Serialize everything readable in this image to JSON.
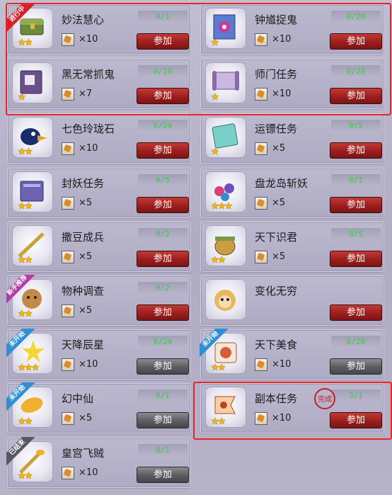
{
  "tag_labels": {
    "active": "进行中",
    "new": "新手推荐",
    "notyet": "未开始",
    "ended": "已结束"
  },
  "seal_text": "完成",
  "quests": [
    {
      "id": "miaofa",
      "name": "妙法慧心",
      "progress": "0/1",
      "qty": "×10",
      "stars": 2,
      "button": "参加",
      "button_style": "red",
      "tag": "active",
      "art": "chest"
    },
    {
      "id": "zhongkui",
      "name": "钟馗捉鬼",
      "progress": "0/20",
      "qty": "×10",
      "stars": 1,
      "button": "参加",
      "button_style": "red",
      "tag": null,
      "art": "scroll-eye"
    },
    {
      "id": "heiwuchang",
      "name": "黑无常抓鬼",
      "progress": "0/10",
      "qty": "×7",
      "stars": 1,
      "button": "参加",
      "button_style": "red",
      "tag": null,
      "art": "book-purple"
    },
    {
      "id": "shimen",
      "name": "师门任务",
      "progress": "0/20",
      "qty": "×10",
      "stars": 1,
      "button": "参加",
      "button_style": "red",
      "tag": null,
      "art": "scroll"
    },
    {
      "id": "qise",
      "name": "七色玲珑石",
      "progress": "0/24",
      "qty": "×10",
      "stars": 2,
      "button": "参加",
      "button_style": "red",
      "tag": null,
      "art": "bird"
    },
    {
      "id": "yunbiao",
      "name": "运镖任务",
      "progress": "0/5",
      "qty": "×5",
      "stars": 1,
      "button": "参加",
      "button_style": "red",
      "tag": null,
      "art": "card-cyan"
    },
    {
      "id": "fengyao",
      "name": "封妖任务",
      "progress": "0/5",
      "qty": "×5",
      "stars": 2,
      "button": "参加",
      "button_style": "red",
      "tag": null,
      "art": "book-blue"
    },
    {
      "id": "panlong",
      "name": "盘龙岛斩妖",
      "progress": "0/1",
      "qty": "×5",
      "stars": 3,
      "button": "参加",
      "button_style": "red",
      "tag": null,
      "art": "treasure"
    },
    {
      "id": "sadou",
      "name": "撒豆成兵",
      "progress": "0/2",
      "qty": "×5",
      "stars": 2,
      "button": "参加",
      "button_style": "red",
      "tag": null,
      "art": "spear"
    },
    {
      "id": "tianxiashijun",
      "name": "天下识君",
      "progress": "0/5",
      "qty": "×5",
      "stars": 2,
      "button": "参加",
      "button_style": "red",
      "tag": null,
      "art": "helmet"
    },
    {
      "id": "wuzhong",
      "name": "物种调查",
      "progress": "0/2",
      "qty": "×5",
      "stars": 2,
      "button": "参加",
      "button_style": "red",
      "tag": "new",
      "art": "monkey"
    },
    {
      "id": "bianhua",
      "name": "变化无穷",
      "progress": "",
      "qty": "",
      "stars": 0,
      "button": "参加",
      "button_style": "red",
      "tag": null,
      "art": "monkey-face"
    },
    {
      "id": "tianjiang",
      "name": "天降辰星",
      "progress": "0/24",
      "qty": "×10",
      "stars": 3,
      "button": "参加",
      "button_style": "grey",
      "tag": "notyet",
      "art": "stars"
    },
    {
      "id": "meishi",
      "name": "天下美食",
      "progress": "0/20",
      "qty": "×10",
      "stars": 2,
      "button": "参加",
      "button_style": "grey",
      "tag": "notyet",
      "art": "food"
    },
    {
      "id": "huanzhong",
      "name": "幻中仙",
      "progress": "0/1",
      "qty": "×5",
      "stars": 2,
      "button": "参加",
      "button_style": "grey",
      "tag": "notyet",
      "art": "leaf"
    },
    {
      "id": "fuben",
      "name": "副本任务",
      "progress": "3/1",
      "qty": "×10",
      "stars": 2,
      "button": "参加",
      "button_style": "red",
      "tag": null,
      "art": "flag",
      "completed": true
    },
    {
      "id": "huanggong",
      "name": "皇宫飞贼",
      "progress": "0/1",
      "qty": "×10",
      "stars": 2,
      "button": "参加",
      "button_style": "grey",
      "tag": "ended",
      "art": "spear2"
    }
  ]
}
